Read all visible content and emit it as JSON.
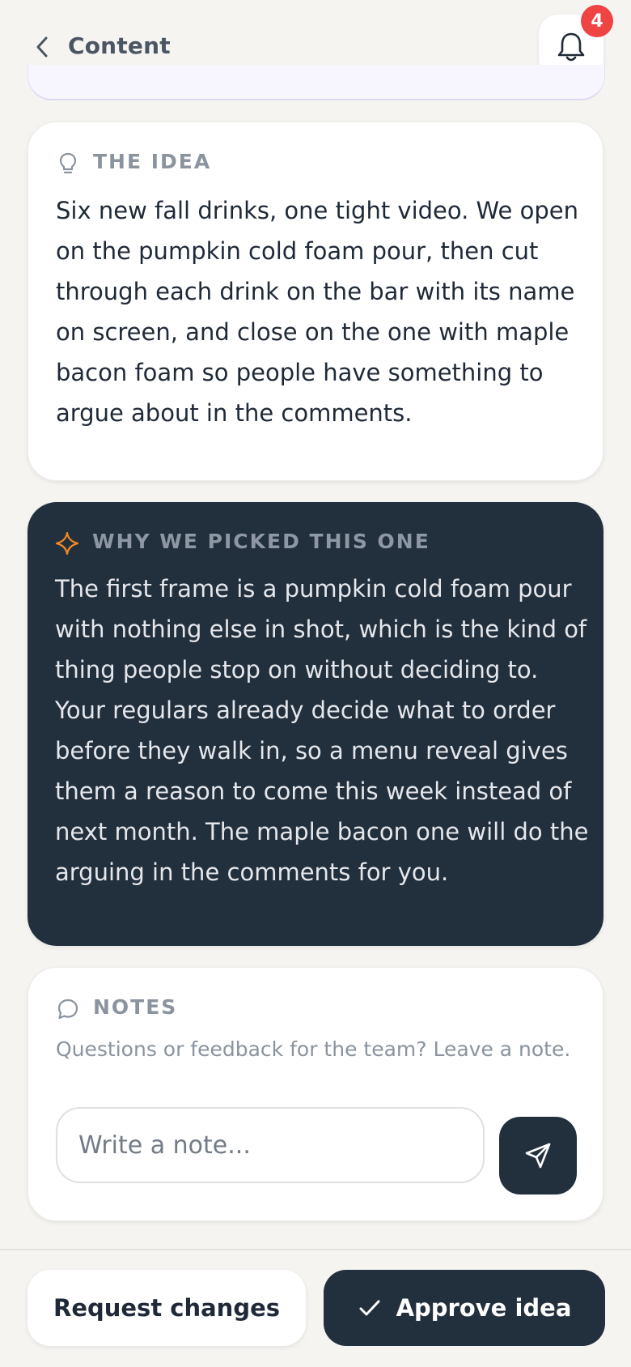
{
  "header": {
    "title": "Content",
    "notification_count": "4"
  },
  "idea": {
    "label": "THE IDEA",
    "body": "Six new fall drinks, one tight video. We open on the pumpkin cold foam pour, then cut through each drink on the bar with its name on screen, and close on the one with maple bacon foam so people have something to argue about in the comments."
  },
  "why": {
    "label": "WHY WE PICKED THIS ONE",
    "body": "The first frame is a pumpkin cold foam pour with nothing else in shot, which is the kind of thing people stop on without deciding to. Your regulars already decide what to order before they walk in, so a menu reveal gives them a reason to come this week instead of next month. The maple bacon one will do the arguing in the comments for you."
  },
  "notes": {
    "label": "NOTES",
    "hint": "Questions or feedback for the team? Leave a note.",
    "input_value": "",
    "input_placeholder": "Write a note..."
  },
  "footer": {
    "request_label": "Request changes",
    "approve_label": "Approve idea"
  },
  "colors": {
    "background": "#f5f4f1",
    "dark": "#222f3d",
    "badge": "#ef4444",
    "accent_orange": "#f08a24"
  },
  "icons": {
    "back": "chevron-left-icon",
    "bell": "bell-icon",
    "idea": "lightbulb-icon",
    "why": "sparkle-icon",
    "notes": "chat-bubble-icon",
    "send": "send-icon",
    "approve": "check-icon"
  }
}
